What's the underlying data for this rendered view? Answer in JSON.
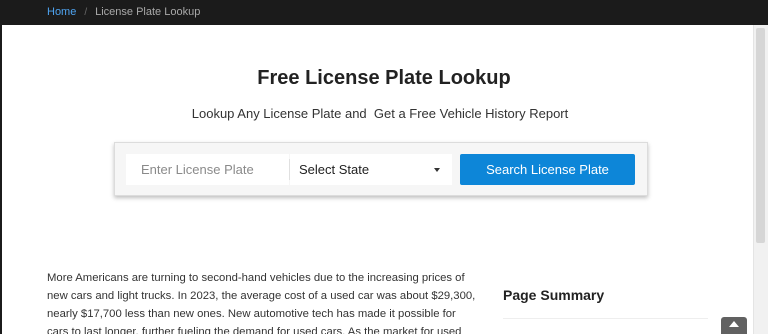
{
  "breadcrumb": {
    "home": "Home",
    "separator": "/",
    "current": "License Plate Lookup"
  },
  "hero": {
    "title": "Free License Plate Lookup",
    "subtitle": "Lookup Any License Plate and  Get a Free Vehicle History Report"
  },
  "search": {
    "plate_placeholder": "Enter License Plate",
    "plate_value": "",
    "state_selected": "Select State",
    "button_label": "Search License Plate"
  },
  "article": {
    "paragraph": "More Americans are turning to second-hand vehicles due to the increasing prices of new cars and light trucks. In 2023, the average cost of a used car was about $29,300, nearly $17,700 less than new ones. New automotive tech has made it possible for cars to last longer, further fueling the demand for used cars. As the market for used"
  },
  "sidebar": {
    "summary_title": "Page Summary"
  },
  "colors": {
    "accent": "#0d86d8",
    "link": "#4ea3f0",
    "topbar": "#1b1b1b"
  },
  "icons": {
    "dropdown": "caret-down-icon",
    "back_to_top": "chevron-up-icon"
  }
}
